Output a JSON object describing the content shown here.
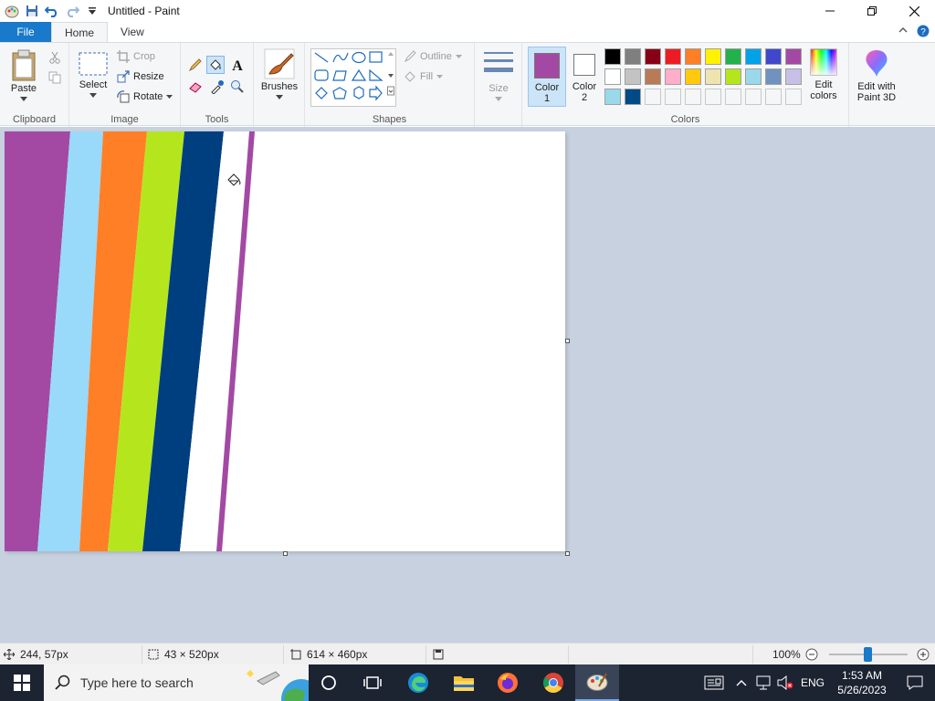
{
  "window": {
    "title": "Untitled - Paint",
    "controls": {
      "minimize": "minimize",
      "maximize": "restore",
      "close": "close"
    }
  },
  "tabs": [
    {
      "label": "File"
    },
    {
      "label": "Home"
    },
    {
      "label": "View"
    }
  ],
  "ribbon": {
    "clipboard": {
      "group_label": "Clipboard",
      "paste": "Paste"
    },
    "image": {
      "group_label": "Image",
      "select": "Select",
      "crop": "Crop",
      "resize": "Resize",
      "rotate": "Rotate"
    },
    "tools": {
      "group_label": "Tools"
    },
    "brushes": {
      "label": "Brushes"
    },
    "shapes": {
      "group_label": "Shapes",
      "outline": "Outline",
      "fill": "Fill",
      "size": "Size"
    },
    "colors": {
      "group_label": "Colors",
      "color1_label": "Color",
      "color1_num": "1",
      "color2_label": "Color",
      "color2_num": "2",
      "color1_value": "#a349a4",
      "color2_value": "#ffffff",
      "edit_colors": "Edit colors",
      "edit_paint3d": "Edit with Paint 3D",
      "palette_row1": [
        "#000000",
        "#7f7f7f",
        "#880015",
        "#ed1c24",
        "#ff7f27",
        "#fff200",
        "#22b14c",
        "#00a2e8",
        "#3f48cc",
        "#a349a4"
      ],
      "palette_row2": [
        "#ffffff",
        "#c3c3c3",
        "#b97a57",
        "#ffaec9",
        "#ffc90e",
        "#efe4b0",
        "#b5e61d",
        "#99d9ea",
        "#7092be",
        "#c8bfe7"
      ],
      "palette_row3": [
        "#99d9ea",
        "#004a85"
      ]
    }
  },
  "canvas": {
    "stripe_colors": [
      "#a349a4",
      "#99d9fa",
      "#ff7f27",
      "#b5e61d",
      "#003f7f",
      "#ffffff",
      "#a349a4"
    ]
  },
  "status": {
    "cursor_pos": "244, 57px",
    "selection_size": "43 × 520px",
    "image_size": "614 × 460px",
    "zoom": "100%"
  },
  "taskbar": {
    "search_placeholder": "Type here to search",
    "language": "ENG",
    "time": "1:53 AM",
    "date": "5/26/2023"
  }
}
